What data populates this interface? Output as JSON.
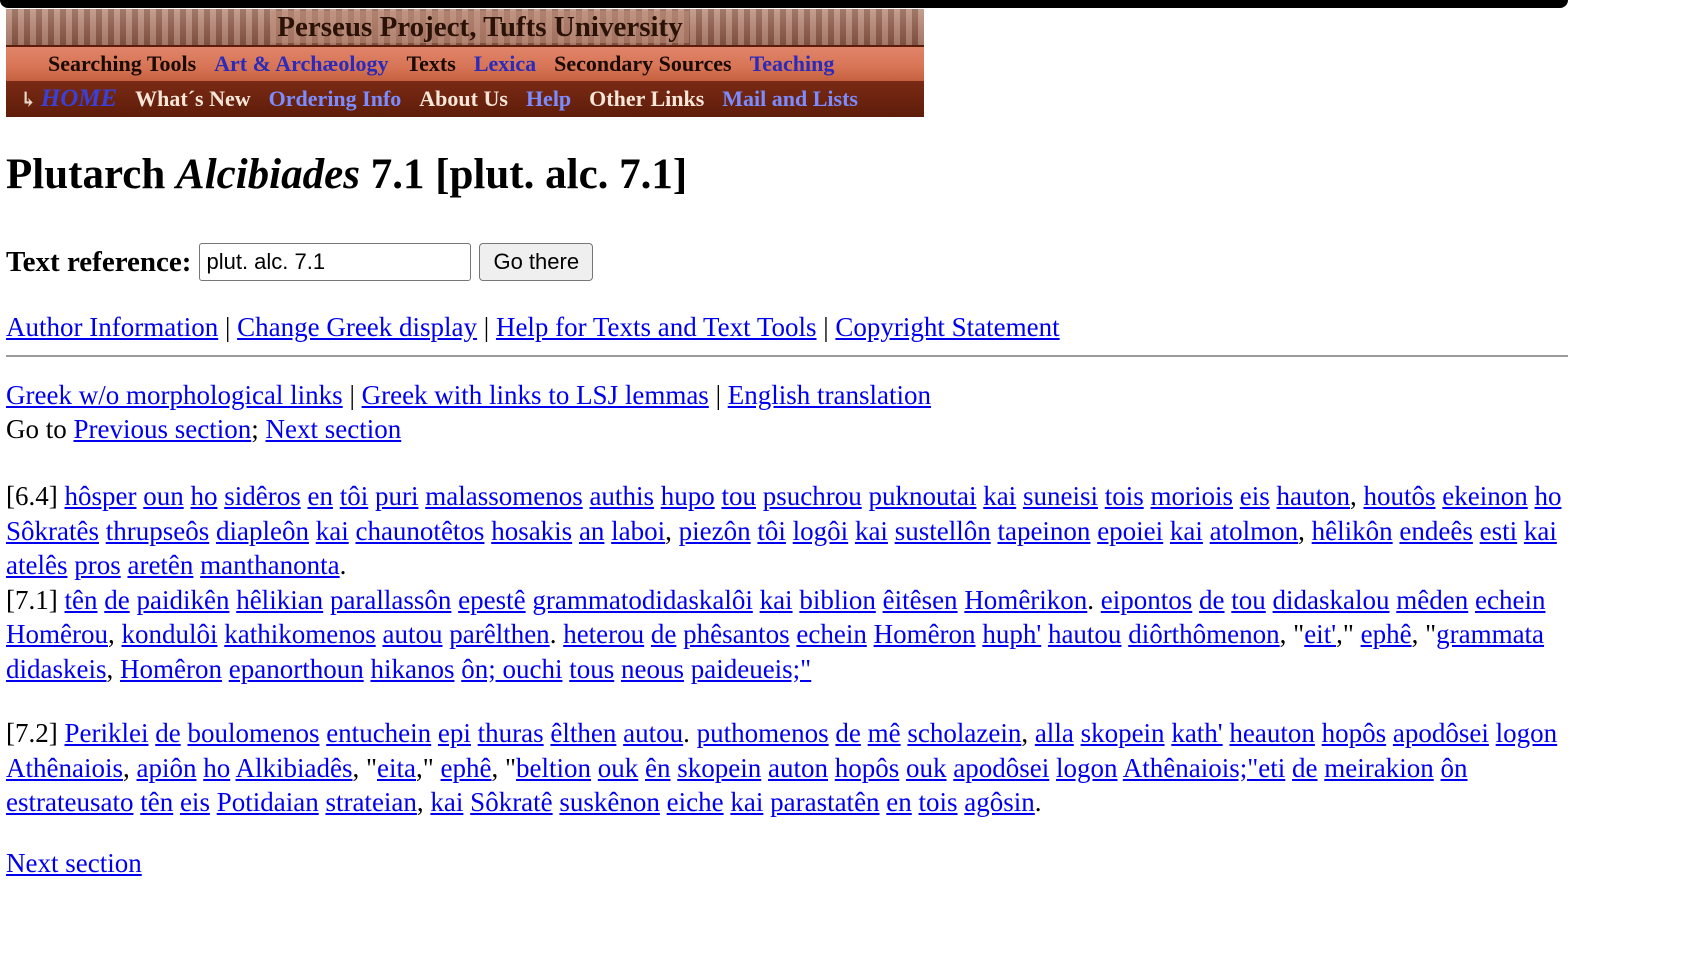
{
  "banner": {
    "title": "Perseus Project, Tufts University",
    "row1": [
      {
        "label": "Searching Tools",
        "style": "dark"
      },
      {
        "label": "Art & Archæology",
        "style": "blue"
      },
      {
        "label": "Texts",
        "style": "dark"
      },
      {
        "label": "Lexica",
        "style": "blue"
      },
      {
        "label": "Secondary Sources",
        "style": "dark"
      },
      {
        "label": "Teaching",
        "style": "blue"
      }
    ],
    "home_label": "HOME",
    "row2": [
      {
        "label": "What´s New",
        "style": "dark"
      },
      {
        "label": "Ordering Info",
        "style": "blue"
      },
      {
        "label": "About Us",
        "style": "dark"
      },
      {
        "label": "Help",
        "style": "blue"
      },
      {
        "label": "Other Links",
        "style": "dark"
      },
      {
        "label": "Mail and Lists",
        "style": "blue"
      }
    ]
  },
  "title": {
    "author": "Plutarch",
    "work": "Alcibiades",
    "section": "7.1 [plut. alc. 7.1]"
  },
  "reference": {
    "label": "Text reference:",
    "value": "plut. alc. 7.1",
    "button": "Go there"
  },
  "tools_links": [
    "Author Information",
    "Change Greek display",
    "Help for Texts and Text Tools",
    "Copyright Statement"
  ],
  "display_links": [
    "Greek w/o morphological links",
    "Greek with links to LSJ lemmas",
    "English translation"
  ],
  "goto": {
    "prefix": "Go to",
    "previous": "Previous section",
    "separator": ";",
    "next": "Next section"
  },
  "paragraphs": [
    [
      {
        "t": "[6.4] "
      },
      {
        "t": "hôsper",
        "l": 1
      },
      {
        "t": " "
      },
      {
        "t": "oun",
        "l": 1
      },
      {
        "t": " "
      },
      {
        "t": "ho",
        "l": 1
      },
      {
        "t": " "
      },
      {
        "t": "sidêros",
        "l": 1
      },
      {
        "t": " "
      },
      {
        "t": "en",
        "l": 1
      },
      {
        "t": " "
      },
      {
        "t": "tôi",
        "l": 1
      },
      {
        "t": " "
      },
      {
        "t": "puri",
        "l": 1
      },
      {
        "t": " "
      },
      {
        "t": "malassomenos",
        "l": 1
      },
      {
        "t": " "
      },
      {
        "t": "authis",
        "l": 1
      },
      {
        "t": " "
      },
      {
        "t": "hupo",
        "l": 1
      },
      {
        "t": " "
      },
      {
        "t": "tou",
        "l": 1
      },
      {
        "t": " "
      },
      {
        "t": "psuchrou",
        "l": 1
      },
      {
        "t": " "
      },
      {
        "t": "puknoutai",
        "l": 1
      },
      {
        "t": " "
      },
      {
        "t": "kai",
        "l": 1
      },
      {
        "t": " "
      },
      {
        "t": "suneisi",
        "l": 1
      },
      {
        "t": " "
      },
      {
        "t": "tois",
        "l": 1
      },
      {
        "t": " "
      },
      {
        "t": "moriois",
        "l": 1
      },
      {
        "t": " "
      },
      {
        "t": "eis",
        "l": 1
      },
      {
        "t": " "
      },
      {
        "t": "hauton",
        "l": 1
      },
      {
        "t": ", "
      },
      {
        "t": "houtôs",
        "l": 1
      },
      {
        "t": " "
      },
      {
        "t": "ekeinon",
        "l": 1
      },
      {
        "t": " "
      },
      {
        "t": "ho",
        "l": 1
      },
      {
        "t": " "
      },
      {
        "t": "Sôkratês",
        "l": 1
      },
      {
        "t": " "
      },
      {
        "t": "thrupseôs",
        "l": 1
      },
      {
        "t": " "
      },
      {
        "t": "diapleôn",
        "l": 1
      },
      {
        "t": " "
      },
      {
        "t": "kai",
        "l": 1
      },
      {
        "t": " "
      },
      {
        "t": "chaunotêtos",
        "l": 1
      },
      {
        "t": " "
      },
      {
        "t": "hosakis",
        "l": 1
      },
      {
        "t": " "
      },
      {
        "t": "an",
        "l": 1
      },
      {
        "t": " "
      },
      {
        "t": "laboi",
        "l": 1
      },
      {
        "t": ", "
      },
      {
        "t": "piezôn",
        "l": 1
      },
      {
        "t": " "
      },
      {
        "t": "tôi",
        "l": 1
      },
      {
        "t": " "
      },
      {
        "t": "logôi",
        "l": 1
      },
      {
        "t": " "
      },
      {
        "t": "kai",
        "l": 1
      },
      {
        "t": " "
      },
      {
        "t": "sustellôn",
        "l": 1
      },
      {
        "t": " "
      },
      {
        "t": "tapeinon",
        "l": 1
      },
      {
        "t": " "
      },
      {
        "t": "epoiei",
        "l": 1
      },
      {
        "t": " "
      },
      {
        "t": "kai",
        "l": 1
      },
      {
        "t": " "
      },
      {
        "t": "atolmon",
        "l": 1
      },
      {
        "t": ", "
      },
      {
        "t": "hêlikôn",
        "l": 1
      },
      {
        "t": " "
      },
      {
        "t": "endeês",
        "l": 1
      },
      {
        "t": " "
      },
      {
        "t": "esti",
        "l": 1
      },
      {
        "t": " "
      },
      {
        "t": "kai",
        "l": 1
      },
      {
        "t": " "
      },
      {
        "t": "atelês",
        "l": 1
      },
      {
        "t": " "
      },
      {
        "t": "pros",
        "l": 1
      },
      {
        "t": " "
      },
      {
        "t": "aretên",
        "l": 1
      },
      {
        "t": " "
      },
      {
        "t": "manthanonta",
        "l": 1
      },
      {
        "t": "."
      },
      {
        "br": 1
      },
      {
        "t": "[7.1] "
      },
      {
        "t": "tên",
        "l": 1
      },
      {
        "t": " "
      },
      {
        "t": "de",
        "l": 1
      },
      {
        "t": " "
      },
      {
        "t": "paidikên",
        "l": 1
      },
      {
        "t": " "
      },
      {
        "t": "hêlikian",
        "l": 1
      },
      {
        "t": " "
      },
      {
        "t": "parallassôn",
        "l": 1
      },
      {
        "t": " "
      },
      {
        "t": "epestê",
        "l": 1
      },
      {
        "t": " "
      },
      {
        "t": "grammatodidaskalôi",
        "l": 1
      },
      {
        "t": " "
      },
      {
        "t": "kai",
        "l": 1
      },
      {
        "t": " "
      },
      {
        "t": "biblion",
        "l": 1
      },
      {
        "t": " "
      },
      {
        "t": "êitêsen",
        "l": 1
      },
      {
        "t": " "
      },
      {
        "t": "Homêrikon",
        "l": 1
      },
      {
        "t": ". "
      },
      {
        "t": "eipontos",
        "l": 1
      },
      {
        "t": " "
      },
      {
        "t": "de",
        "l": 1
      },
      {
        "t": " "
      },
      {
        "t": "tou",
        "l": 1
      },
      {
        "t": " "
      },
      {
        "t": "didaskalou",
        "l": 1
      },
      {
        "t": " "
      },
      {
        "t": "mêden",
        "l": 1
      },
      {
        "t": " "
      },
      {
        "t": "echein",
        "l": 1
      },
      {
        "t": " "
      },
      {
        "t": "Homêrou",
        "l": 1
      },
      {
        "t": ", "
      },
      {
        "t": "kondulôi",
        "l": 1
      },
      {
        "t": " "
      },
      {
        "t": "kathikomenos",
        "l": 1
      },
      {
        "t": " "
      },
      {
        "t": "autou",
        "l": 1
      },
      {
        "t": " "
      },
      {
        "t": "parêlthen",
        "l": 1
      },
      {
        "t": ". "
      },
      {
        "t": "heterou",
        "l": 1
      },
      {
        "t": " "
      },
      {
        "t": "de",
        "l": 1
      },
      {
        "t": " "
      },
      {
        "t": "phêsantos",
        "l": 1
      },
      {
        "t": " "
      },
      {
        "t": "echein",
        "l": 1
      },
      {
        "t": " "
      },
      {
        "t": "Homêron",
        "l": 1
      },
      {
        "t": " "
      },
      {
        "t": "huph'",
        "l": 1
      },
      {
        "t": " "
      },
      {
        "t": "hautou",
        "l": 1
      },
      {
        "t": " "
      },
      {
        "t": "diôrthômenon",
        "l": 1
      },
      {
        "t": ", \""
      },
      {
        "t": "eit'",
        "l": 1
      },
      {
        "t": ",\" "
      },
      {
        "t": "ephê",
        "l": 1
      },
      {
        "t": ", \""
      },
      {
        "t": "grammata",
        "l": 1
      },
      {
        "t": " "
      },
      {
        "t": "didaskeis",
        "l": 1
      },
      {
        "t": ", "
      },
      {
        "t": "Homêron",
        "l": 1
      },
      {
        "t": " "
      },
      {
        "t": "epanorthoun",
        "l": 1
      },
      {
        "t": " "
      },
      {
        "t": "hikanos",
        "l": 1
      },
      {
        "t": " "
      },
      {
        "t": "ôn; ouchi",
        "l": 1
      },
      {
        "t": " "
      },
      {
        "t": "tous",
        "l": 1
      },
      {
        "t": " "
      },
      {
        "t": "neous",
        "l": 1
      },
      {
        "t": " "
      },
      {
        "t": "paideueis;\"",
        "l": 1
      }
    ],
    [
      {
        "t": "[7.2] "
      },
      {
        "t": "Periklei",
        "l": 1
      },
      {
        "t": " "
      },
      {
        "t": "de",
        "l": 1
      },
      {
        "t": " "
      },
      {
        "t": "boulomenos",
        "l": 1
      },
      {
        "t": " "
      },
      {
        "t": "entuchein",
        "l": 1
      },
      {
        "t": " "
      },
      {
        "t": "epi",
        "l": 1
      },
      {
        "t": " "
      },
      {
        "t": "thuras",
        "l": 1
      },
      {
        "t": " "
      },
      {
        "t": "êlthen",
        "l": 1
      },
      {
        "t": " "
      },
      {
        "t": "autou",
        "l": 1
      },
      {
        "t": ". "
      },
      {
        "t": "puthomenos",
        "l": 1
      },
      {
        "t": " "
      },
      {
        "t": "de",
        "l": 1
      },
      {
        "t": " "
      },
      {
        "t": "mê",
        "l": 1
      },
      {
        "t": " "
      },
      {
        "t": "scholazein",
        "l": 1
      },
      {
        "t": ", "
      },
      {
        "t": "alla",
        "l": 1
      },
      {
        "t": " "
      },
      {
        "t": "skopein",
        "l": 1
      },
      {
        "t": " "
      },
      {
        "t": "kath'",
        "l": 1
      },
      {
        "t": " "
      },
      {
        "t": "heauton",
        "l": 1
      },
      {
        "t": " "
      },
      {
        "t": "hopôs",
        "l": 1
      },
      {
        "t": " "
      },
      {
        "t": "apodôsei",
        "l": 1
      },
      {
        "t": " "
      },
      {
        "t": "logon",
        "l": 1
      },
      {
        "t": " "
      },
      {
        "t": "Athênaiois",
        "l": 1
      },
      {
        "t": ", "
      },
      {
        "t": "apiôn",
        "l": 1
      },
      {
        "t": " "
      },
      {
        "t": "ho",
        "l": 1
      },
      {
        "t": " "
      },
      {
        "t": "Alkibiadês",
        "l": 1
      },
      {
        "t": ", \""
      },
      {
        "t": "eita",
        "l": 1
      },
      {
        "t": ",\" "
      },
      {
        "t": "ephê",
        "l": 1
      },
      {
        "t": ", \""
      },
      {
        "t": "beltion",
        "l": 1
      },
      {
        "t": " "
      },
      {
        "t": "ouk",
        "l": 1
      },
      {
        "t": " "
      },
      {
        "t": "ên",
        "l": 1
      },
      {
        "t": " "
      },
      {
        "t": "skopein",
        "l": 1
      },
      {
        "t": " "
      },
      {
        "t": "auton",
        "l": 1
      },
      {
        "t": " "
      },
      {
        "t": "hopôs",
        "l": 1
      },
      {
        "t": " "
      },
      {
        "t": "ouk",
        "l": 1
      },
      {
        "t": " "
      },
      {
        "t": "apodôsei",
        "l": 1
      },
      {
        "t": " "
      },
      {
        "t": "logon",
        "l": 1
      },
      {
        "t": " "
      },
      {
        "t": "Athênaiois;\"eti",
        "l": 1
      },
      {
        "t": " "
      },
      {
        "t": "de",
        "l": 1
      },
      {
        "t": " "
      },
      {
        "t": "meirakion",
        "l": 1
      },
      {
        "t": " "
      },
      {
        "t": "ôn",
        "l": 1
      },
      {
        "t": " "
      },
      {
        "t": "estrateusato",
        "l": 1
      },
      {
        "t": " "
      },
      {
        "t": "tên",
        "l": 1
      },
      {
        "t": " "
      },
      {
        "t": "eis",
        "l": 1
      },
      {
        "t": " "
      },
      {
        "t": "Potidaian",
        "l": 1
      },
      {
        "t": " "
      },
      {
        "t": "strateian",
        "l": 1
      },
      {
        "t": ", "
      },
      {
        "t": "kai",
        "l": 1
      },
      {
        "t": " "
      },
      {
        "t": "Sôkratê",
        "l": 1
      },
      {
        "t": " "
      },
      {
        "t": "suskênon",
        "l": 1
      },
      {
        "t": " "
      },
      {
        "t": "eiche",
        "l": 1
      },
      {
        "t": " "
      },
      {
        "t": "kai",
        "l": 1
      },
      {
        "t": " "
      },
      {
        "t": "parastatên",
        "l": 1
      },
      {
        "t": " "
      },
      {
        "t": "en",
        "l": 1
      },
      {
        "t": " "
      },
      {
        "t": "tois",
        "l": 1
      },
      {
        "t": " "
      },
      {
        "t": "agôsin",
        "l": 1
      },
      {
        "t": "."
      }
    ]
  ],
  "footer": {
    "next_label": "Next section"
  }
}
